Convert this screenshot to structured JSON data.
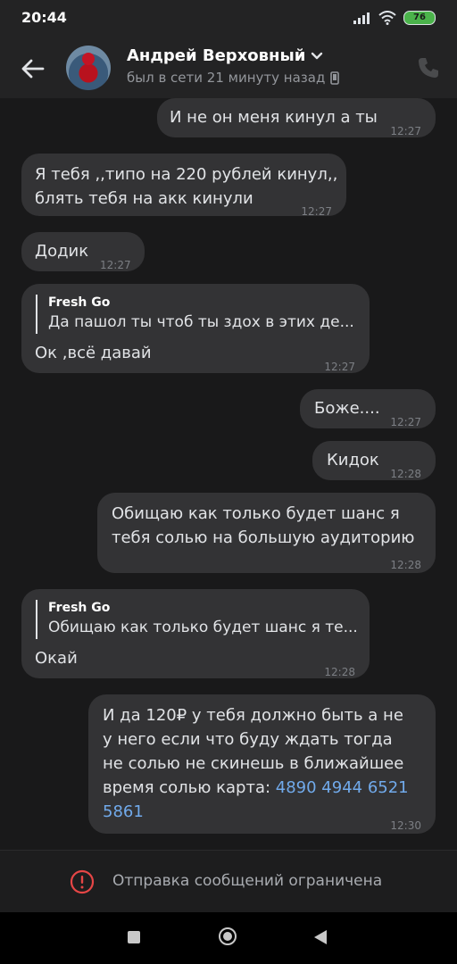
{
  "status_bar": {
    "time": "20:44",
    "battery": "76",
    "icons": [
      "signal-icon",
      "wifi-icon",
      "battery-icon"
    ]
  },
  "header": {
    "back_icon": "arrow-left-icon",
    "contact_name": "Андрей Верховный",
    "status": "был в сети 21 минуту назад",
    "status_icon": "mobile-phone-icon",
    "call_icon": "phone-icon",
    "dropdown_icon": "chevron-down-icon"
  },
  "messages": [
    {
      "direction": "out",
      "text": "И не он меня кинул а ты",
      "time": "12:27"
    },
    {
      "direction": "in",
      "text_line1": "Я тебя ,,типо на 220 рублей кинул,,",
      "text_line2": "блять тебя на акк кинули",
      "time": "12:27"
    },
    {
      "direction": "in",
      "text": "Додик",
      "time": "12:27"
    },
    {
      "direction": "in",
      "reply_author": "Fresh Go",
      "reply_text": "Да пашол ты чтоб ты здох в этих де...",
      "text": "Ок ,всё давай",
      "time": "12:27"
    },
    {
      "direction": "out",
      "text": "Боже....",
      "time": "12:27"
    },
    {
      "direction": "out",
      "text": "Кидок",
      "time": "12:28"
    },
    {
      "direction": "out",
      "text_line1": "Обищаю как только будет шанс я",
      "text_line2": "тебя солью на большую аудиторию",
      "time": "12:28"
    },
    {
      "direction": "in",
      "reply_author": "Fresh Go",
      "reply_text": "Обищаю как только будет шанс я те...",
      "text": "Окай",
      "time": "12:28"
    },
    {
      "direction": "out",
      "text_line1": "И да 120₽ у тебя должно быть а не",
      "text_line2": "у него если что буду ждать тогда",
      "text_line3": "не солью не скинешь в ближайшее",
      "text_line4": "время солью карта: ",
      "card_part1": "4890 4944 6521",
      "card_part2": "5861",
      "time": "12:30"
    }
  ],
  "composer": {
    "icon": "exclamation-circle-icon",
    "notice": "Отправка сообщений ограничена",
    "accent_color": "#e64646"
  },
  "nav_bar": {
    "icons": [
      "recent-apps-icon",
      "home-icon",
      "back-icon"
    ]
  }
}
